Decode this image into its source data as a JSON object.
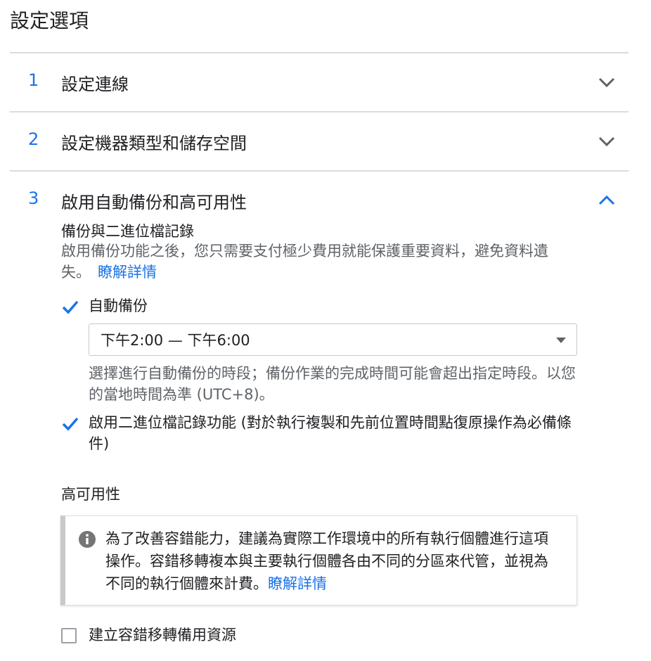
{
  "page": {
    "title": "設定選項"
  },
  "sections": [
    {
      "number": "1",
      "title": "設定連線",
      "expanded": false
    },
    {
      "number": "2",
      "title": "設定機器類型和儲存空間",
      "expanded": false
    },
    {
      "number": "3",
      "title": "啟用自動備份和高可用性",
      "expanded": true
    }
  ],
  "backup": {
    "heading": "備份與二進位檔記錄",
    "description": "啟用備份功能之後，您只需要支付極少費用就能保護重要資料，避免資料遺失。",
    "learn_more": "瞭解詳情",
    "auto_backup": {
      "label": "自動備份",
      "checked": true
    },
    "window_select": {
      "value": "下午2:00 — 下午6:00"
    },
    "window_help": "選擇進行自動備份的時段；備份作業的完成時間可能會超出指定時段。以您的當地時間為準 (UTC+8)。",
    "binary_logging": {
      "label": "啟用二進位檔記錄功能 (對於執行複製和先前位置時間點復原操作為必備條件)",
      "checked": true
    }
  },
  "high_availability": {
    "heading": "高可用性",
    "info": "為了改善容錯能力，建議為實際工作環境中的所有執行個體進行這項操作。容錯移轉複本與主要執行個體各由不同的分區來代管，並視為不同的執行個體來計費。",
    "learn_more": "瞭解詳情",
    "failover": {
      "label": "建立容錯移轉備用資源",
      "checked": false
    }
  },
  "colors": {
    "accent": "#1a73e8",
    "text": "#202124",
    "secondary": "#5f6368",
    "divider": "#dadce0"
  }
}
